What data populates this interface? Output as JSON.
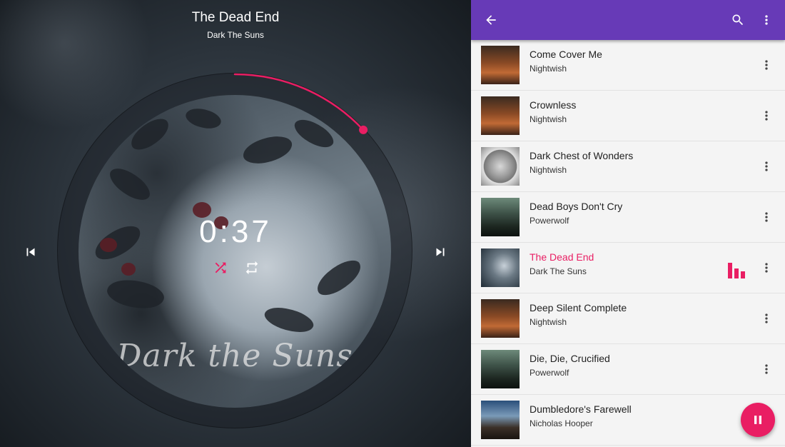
{
  "now_playing": {
    "title": "The Dead End",
    "artist": "Dark The Suns",
    "time": "0:37",
    "album_art_text": "Dark the Suns",
    "progress_fraction": 0.13,
    "accent": "#e91e63"
  },
  "controls": {
    "shuffle_icon": "shuffle-icon",
    "repeat_icon": "repeat-icon",
    "prev_icon": "skip-previous-icon",
    "next_icon": "skip-next-icon"
  },
  "appbar": {
    "color": "#673ab7",
    "back_icon": "arrow-back-icon",
    "search_icon": "search-icon",
    "menu_icon": "more-vert-icon"
  },
  "songs": [
    {
      "title": "Come Cover Me",
      "artist": "Nightwish",
      "art": "nightwish-orange"
    },
    {
      "title": "Crownless",
      "artist": "Nightwish",
      "art": "nightwish-orange"
    },
    {
      "title": "Dark Chest of Wonders",
      "artist": "Nightwish",
      "art": "nightwish-silver"
    },
    {
      "title": "Dead Boys Don't Cry",
      "artist": "Powerwolf",
      "art": "powerwolf"
    },
    {
      "title": "The Dead End",
      "artist": "Dark The Suns",
      "art": "dark-the-suns",
      "playing": true
    },
    {
      "title": "Deep Silent Complete",
      "artist": "Nightwish",
      "art": "nightwish-orange"
    },
    {
      "title": "Die, Die, Crucified",
      "artist": "Powerwolf",
      "art": "powerwolf"
    },
    {
      "title": "Dumbledore's Farewell",
      "artist": "Nicholas Hooper",
      "art": "harry-potter"
    }
  ],
  "fab": {
    "icon": "pause-icon",
    "color": "#e91e63"
  }
}
